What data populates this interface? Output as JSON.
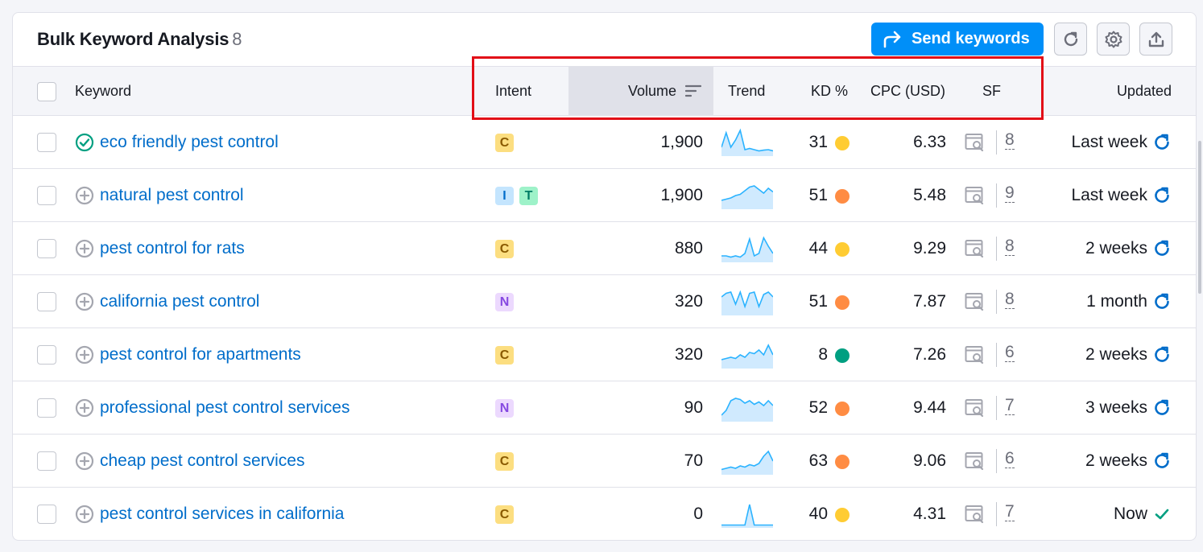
{
  "title": "Bulk Keyword Analysis",
  "count": "8",
  "send_label": "Send keywords",
  "columns": {
    "keyword": "Keyword",
    "intent": "Intent",
    "volume": "Volume",
    "trend": "Trend",
    "kd": "KD %",
    "cpc": "CPC (USD)",
    "sf": "SF",
    "updated": "Updated"
  },
  "colors": {
    "accent": "#008ff8",
    "link": "#006dca",
    "highlight": "#e20e17",
    "kd_yellow": "#ffcc33",
    "kd_orange": "#ff8c43",
    "kd_green": "#009f81"
  },
  "rows": [
    {
      "keyword": "eco friendly pest control",
      "status": "added",
      "intents": [
        "C"
      ],
      "volume": "1,900",
      "kd": "31",
      "kd_color": "#ffcc33",
      "cpc": "6.33",
      "sf": "8",
      "updated": "Last week",
      "updated_icon": "refresh-icon",
      "trend": [
        0.3,
        0.9,
        0.3,
        0.6,
        1,
        0.2,
        0.25,
        0.2,
        0.15,
        0.18,
        0.2,
        0.15
      ]
    },
    {
      "keyword": "natural pest control",
      "status": "add",
      "intents": [
        "I",
        "T"
      ],
      "volume": "1,900",
      "kd": "51",
      "kd_color": "#ff8c43",
      "cpc": "5.48",
      "sf": "9",
      "updated": "Last week",
      "updated_icon": "refresh-icon",
      "trend": [
        0.3,
        0.35,
        0.4,
        0.5,
        0.55,
        0.7,
        0.85,
        0.9,
        0.75,
        0.6,
        0.8,
        0.65
      ]
    },
    {
      "keyword": "pest control for rats",
      "status": "add",
      "intents": [
        "C"
      ],
      "volume": "880",
      "kd": "44",
      "kd_color": "#ffcc33",
      "cpc": "9.29",
      "sf": "8",
      "updated": "2 weeks",
      "updated_icon": "refresh-icon",
      "trend": [
        0.2,
        0.2,
        0.15,
        0.2,
        0.15,
        0.3,
        0.9,
        0.2,
        0.3,
        0.95,
        0.6,
        0.3
      ]
    },
    {
      "keyword": "california pest control",
      "status": "add",
      "intents": [
        "N"
      ],
      "volume": "320",
      "kd": "51",
      "kd_color": "#ff8c43",
      "cpc": "7.87",
      "sf": "8",
      "updated": "1 month",
      "updated_icon": "refresh-icon",
      "trend": [
        0.7,
        0.85,
        0.9,
        0.4,
        0.9,
        0.3,
        0.85,
        0.9,
        0.3,
        0.8,
        0.9,
        0.7
      ]
    },
    {
      "keyword": "pest control for apartments",
      "status": "add",
      "intents": [
        "C"
      ],
      "volume": "320",
      "kd": "8",
      "kd_color": "#009f81",
      "cpc": "7.26",
      "sf": "6",
      "updated": "2 weeks",
      "updated_icon": "refresh-icon",
      "trend": [
        0.3,
        0.35,
        0.4,
        0.35,
        0.5,
        0.4,
        0.6,
        0.55,
        0.7,
        0.5,
        0.9,
        0.5
      ]
    },
    {
      "keyword": "professional pest control services",
      "status": "add",
      "intents": [
        "N"
      ],
      "volume": "90",
      "kd": "52",
      "kd_color": "#ff8c43",
      "cpc": "9.44",
      "sf": "7",
      "updated": "3 weeks",
      "updated_icon": "refresh-icon",
      "trend": [
        0.2,
        0.4,
        0.8,
        0.9,
        0.85,
        0.7,
        0.8,
        0.65,
        0.75,
        0.6,
        0.8,
        0.6
      ]
    },
    {
      "keyword": "cheap pest control services",
      "status": "add",
      "intents": [
        "C"
      ],
      "volume": "70",
      "kd": "63",
      "kd_color": "#ff8c43",
      "cpc": "9.06",
      "sf": "6",
      "updated": "2 weeks",
      "updated_icon": "refresh-icon",
      "trend": [
        0.15,
        0.2,
        0.25,
        0.2,
        0.3,
        0.25,
        0.35,
        0.3,
        0.4,
        0.7,
        0.9,
        0.5
      ]
    },
    {
      "keyword": "pest control services in california",
      "status": "add",
      "intents": [
        "C"
      ],
      "volume": "0",
      "kd": "40",
      "kd_color": "#ffcc33",
      "cpc": "4.31",
      "sf": "7",
      "updated": "Now",
      "updated_icon": "check-icon",
      "trend": [
        0.05,
        0.05,
        0.05,
        0.05,
        0.05,
        0.05,
        0.9,
        0.05,
        0.05,
        0.05,
        0.05,
        0.05
      ]
    }
  ]
}
